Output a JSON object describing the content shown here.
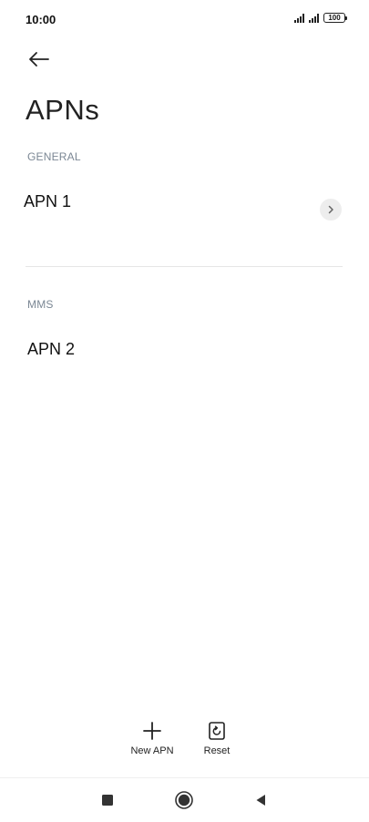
{
  "status_bar": {
    "time": "10:00",
    "battery": "100",
    "icons": [
      "signal-icon",
      "signal-icon",
      "battery-icon"
    ]
  },
  "header": {
    "back_icon": "arrow-left-icon",
    "title": "APNs"
  },
  "sections": [
    {
      "header": "GENERAL",
      "items": [
        {
          "label": "APN 1",
          "selected_indicator": "chevron-right-icon"
        }
      ]
    },
    {
      "header": "MMS",
      "items": [
        {
          "label": "APN 2"
        }
      ]
    }
  ],
  "actions": [
    {
      "label": "New APN",
      "icon": "plus-icon"
    },
    {
      "label": "Reset",
      "icon": "reset-icon"
    }
  ],
  "nav_bar": {
    "buttons": [
      "recents-square-icon",
      "home-circle-icon",
      "back-triangle-icon"
    ]
  },
  "colors": {
    "section_header": "#7b8794",
    "divider": "#e6e6e6",
    "chevron_bg": "#ededed"
  }
}
